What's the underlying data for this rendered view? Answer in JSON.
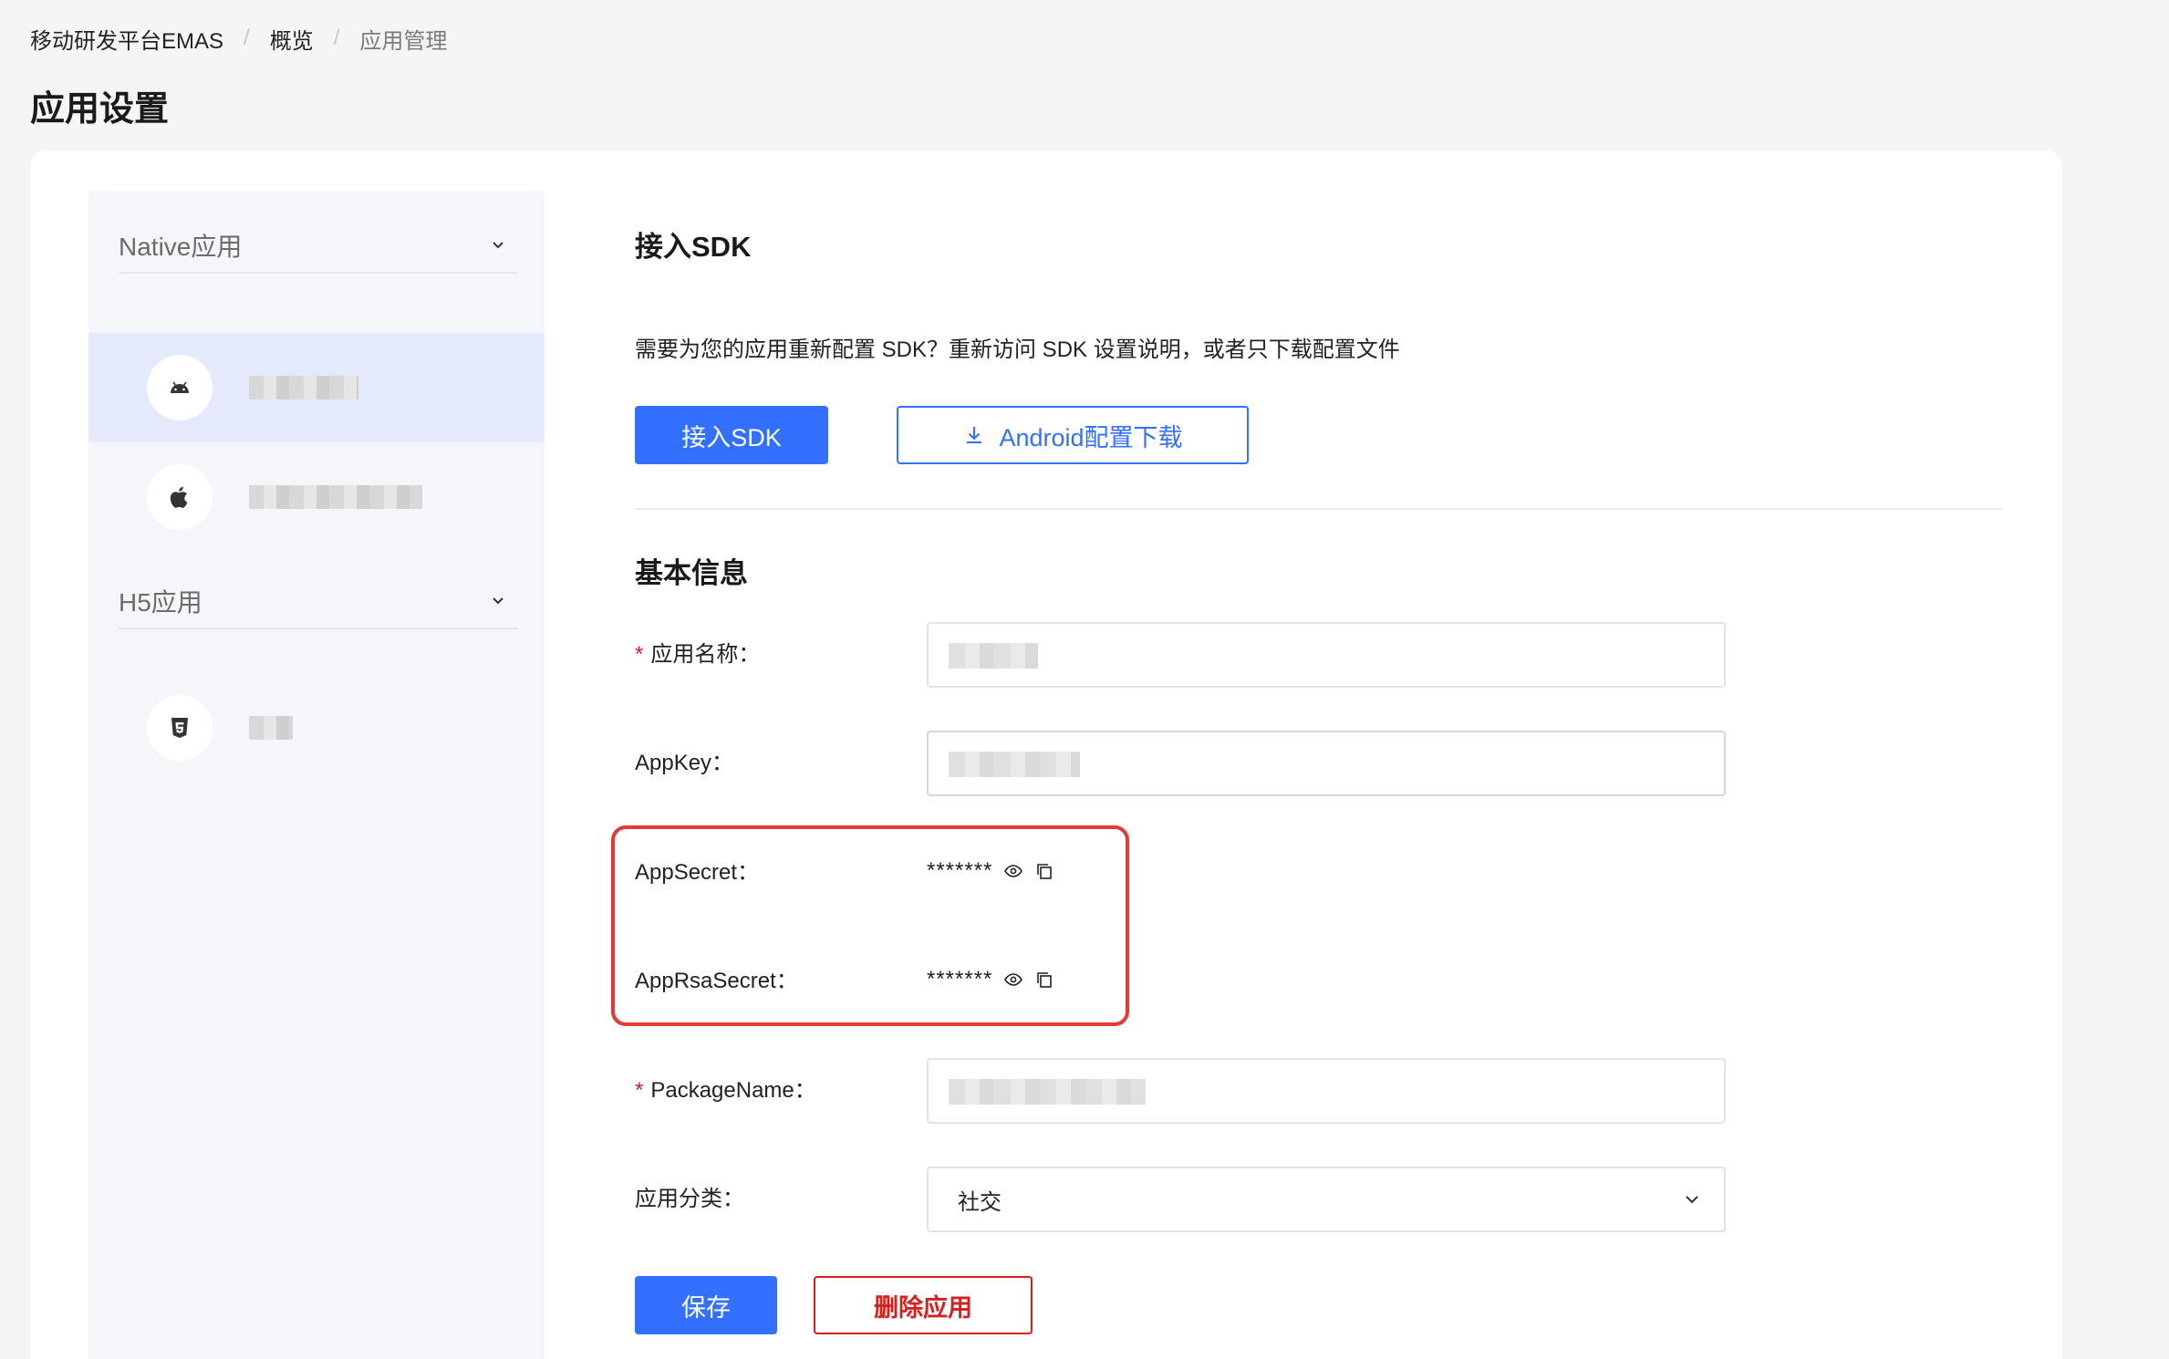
{
  "breadcrumb": {
    "items": [
      "移动研发平台EMAS",
      "概览",
      "应用管理"
    ],
    "separator": "/"
  },
  "page_title": "应用设置",
  "sidebar": {
    "groups": [
      {
        "label": "Native应用",
        "apps": [
          {
            "platform": "android-icon",
            "name_redacted": true,
            "active": true
          },
          {
            "platform": "apple-icon",
            "name_redacted": true,
            "active": false
          }
        ]
      },
      {
        "label": "H5应用",
        "apps": [
          {
            "platform": "html5-icon",
            "name_redacted": true,
            "active": false
          }
        ]
      }
    ]
  },
  "sdk": {
    "title": "接入SDK",
    "description": "需要为您的应用重新配置 SDK？重新访问 SDK 设置说明，或者只下载配置文件",
    "primary_button": "接入SDK",
    "download_button": "Android配置下载"
  },
  "basic_info": {
    "title": "基本信息",
    "app_name_label": "应用名称：",
    "appkey_label": "AppKey：",
    "appsecret_label": "AppSecret：",
    "appsecret_value": "*******",
    "apprsasecret_label": "AppRsaSecret：",
    "apprsasecret_value": "*******",
    "packagename_label": "PackageName：",
    "category_label": "应用分类：",
    "category_value": "社交",
    "required_mark": "*"
  },
  "actions": {
    "save_label": "保存",
    "delete_label": "删除应用"
  },
  "colors": {
    "primary": "#3370ff",
    "danger": "#d81e1e",
    "highlight": "#e53935",
    "active_item_bg": "#e4e9fb"
  }
}
